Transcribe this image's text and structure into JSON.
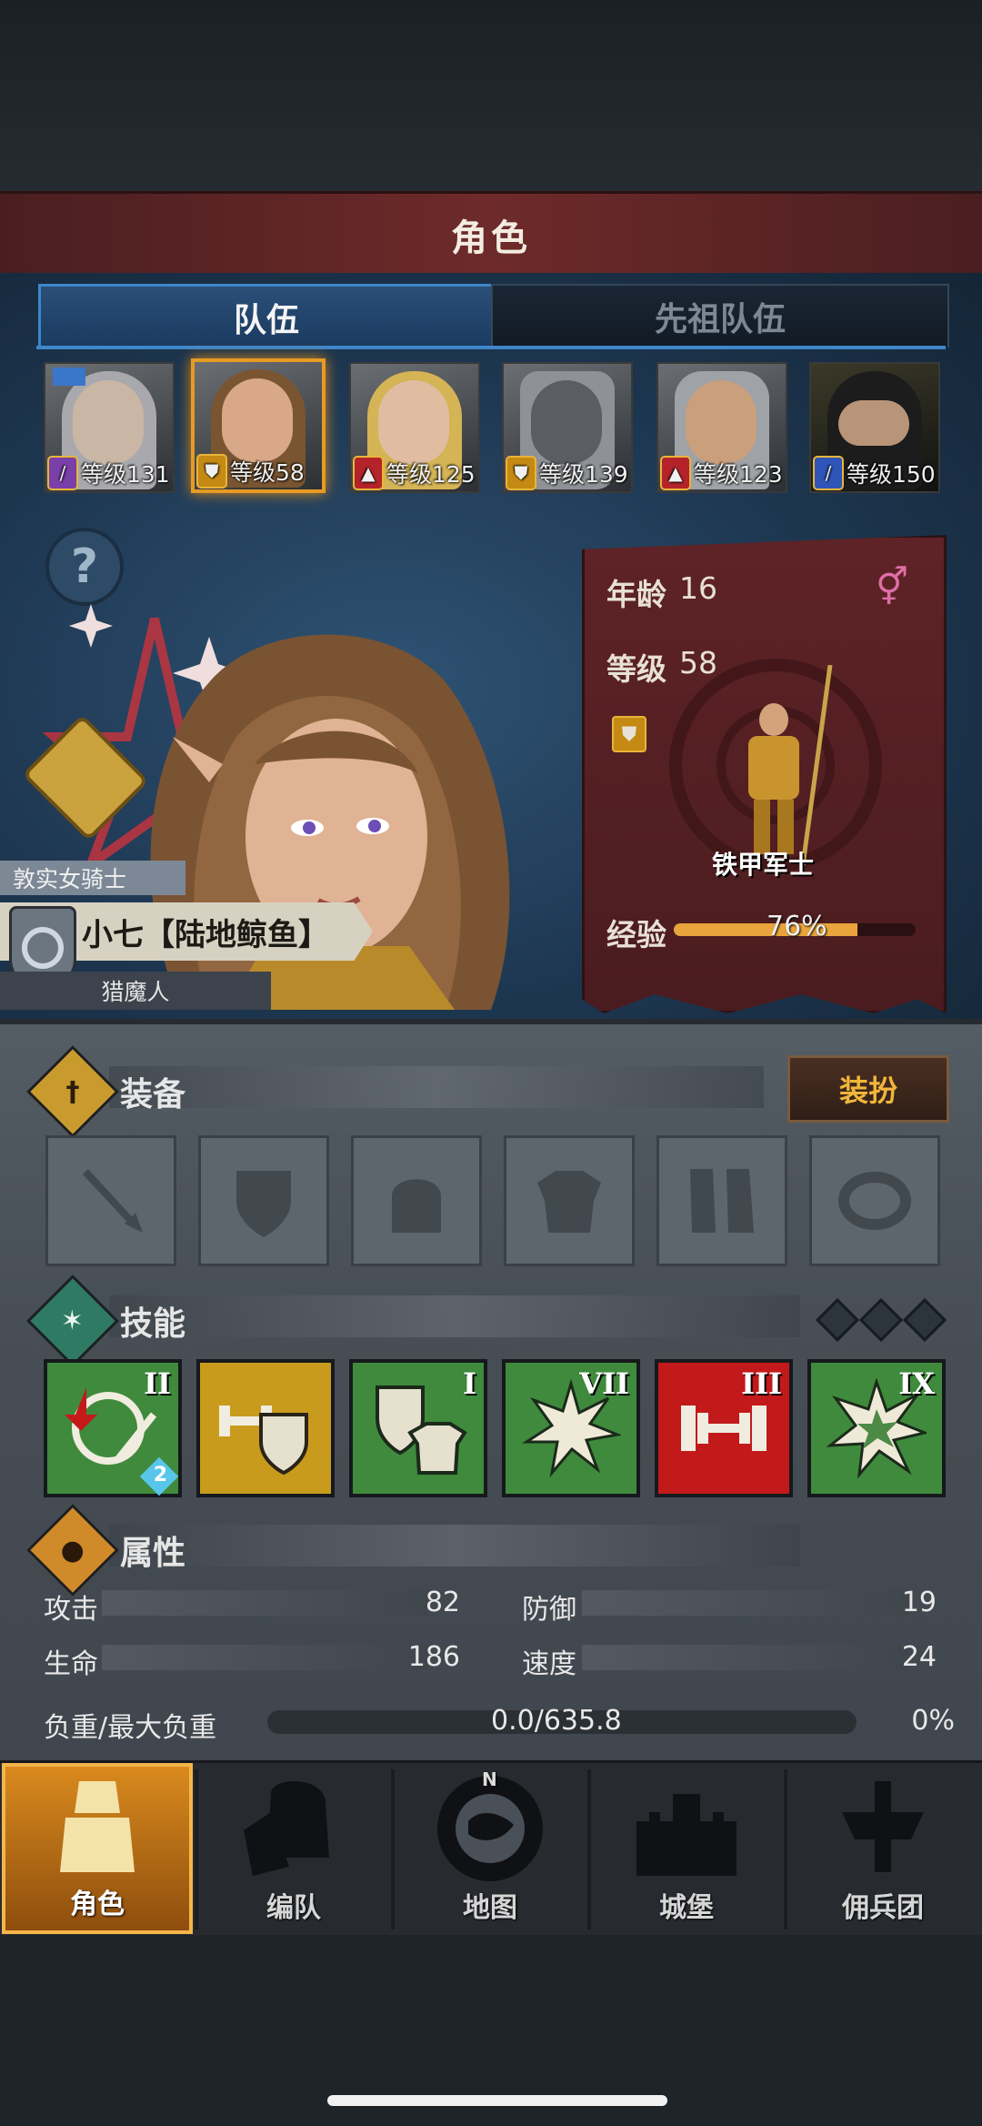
{
  "header": {
    "title": "角色"
  },
  "tabs": [
    {
      "label": "队伍",
      "active": true
    },
    {
      "label": "先祖队伍",
      "active": false
    }
  ],
  "party": [
    {
      "level_label": "等级131",
      "class_icon": "staff-icon",
      "class_color": "#7a3fa8",
      "selected": false
    },
    {
      "level_label": "等级58",
      "class_icon": "shield-icon",
      "class_color": "#c58a14",
      "selected": true
    },
    {
      "level_label": "等级125",
      "class_icon": "wolf-icon",
      "class_color": "#b5232a",
      "selected": false
    },
    {
      "level_label": "等级139",
      "class_icon": "shield-icon",
      "class_color": "#c58a14",
      "selected": false
    },
    {
      "level_label": "等级123",
      "class_icon": "wolf-icon",
      "class_color": "#b5232a",
      "selected": false
    },
    {
      "level_label": "等级150",
      "class_icon": "sword-icon",
      "class_color": "#2f55b8",
      "selected": false
    }
  ],
  "info": {
    "age_label": "年龄",
    "age": "16",
    "level_label": "等级",
    "level": "58",
    "unit_name": "铁甲军士",
    "exp_label": "经验",
    "exp_percent_label": "76%",
    "exp_fraction": 0.76,
    "gender_symbol": "⚥"
  },
  "character": {
    "trait": "敦实女骑士",
    "name": "小七【陆地鲸鱼】",
    "subtitle": "猎魔人"
  },
  "equipment": {
    "title": "装备",
    "dress_button": "装扮",
    "slots": [
      "weapon-slot",
      "shield-slot",
      "helmet-slot",
      "armor-slot",
      "boots-slot",
      "ring-slot"
    ]
  },
  "skills": {
    "title": "技能",
    "items": [
      {
        "rank": "II",
        "bg": "#3f8a3c",
        "badge": "2"
      },
      {
        "rank": "",
        "bg": "#c99b1d"
      },
      {
        "rank": "I",
        "bg": "#3f8a3c"
      },
      {
        "rank": "VII",
        "bg": "#3f8a3c"
      },
      {
        "rank": "III",
        "bg": "#c21a1a"
      },
      {
        "rank": "IX",
        "bg": "#3f8a3c"
      }
    ]
  },
  "attributes": {
    "title": "属性",
    "attack_label": "攻击",
    "attack": "82",
    "defense_label": "防御",
    "defense": "19",
    "hp_label": "生命",
    "hp": "186",
    "speed_label": "速度",
    "speed": "24",
    "load_label": "负重/最大负重",
    "load": "0.0/635.8",
    "load_percent": "0%"
  },
  "nav": [
    {
      "label": "角色",
      "active": true
    },
    {
      "label": "编队",
      "active": false
    },
    {
      "label": "地图",
      "active": false
    },
    {
      "label": "城堡",
      "active": false
    },
    {
      "label": "佣兵团",
      "active": false
    }
  ],
  "map_compass_letter": "N"
}
